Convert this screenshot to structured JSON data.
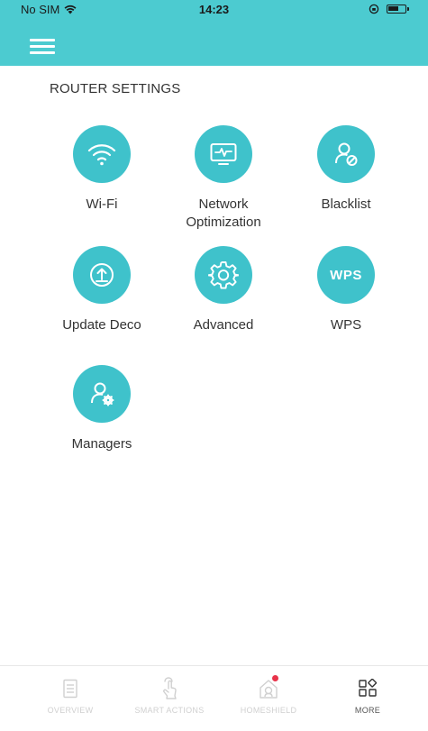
{
  "status_bar": {
    "carrier": "No SIM",
    "time": "14:23"
  },
  "header": {
    "menu_icon": "hamburger-menu-icon",
    "color": "#4ccbd0"
  },
  "section": {
    "title": "ROUTER SETTINGS"
  },
  "items": [
    {
      "icon": "wifi-icon",
      "label": "Wi-Fi"
    },
    {
      "icon": "network-optimization-icon",
      "label": "Network Optimization"
    },
    {
      "icon": "blacklist-icon",
      "label": "Blacklist"
    },
    {
      "icon": "update-icon",
      "label": "Update Deco"
    },
    {
      "icon": "gear-icon",
      "label": "Advanced"
    },
    {
      "icon": "wps-icon",
      "label": "WPS",
      "icon_text": "WPS"
    },
    {
      "icon": "managers-icon",
      "label": "Managers"
    }
  ],
  "tabs": [
    {
      "icon": "overview-icon",
      "label": "OVERVIEW",
      "active": false
    },
    {
      "icon": "smart-actions-icon",
      "label": "SMART ACTIONS",
      "active": false
    },
    {
      "icon": "homeshield-icon",
      "label": "HOMESHIELD",
      "active": false,
      "badge": true
    },
    {
      "icon": "more-icon",
      "label": "MORE",
      "active": true
    }
  ],
  "colors": {
    "accent": "#3fc2cb",
    "badge": "#e8334a"
  }
}
